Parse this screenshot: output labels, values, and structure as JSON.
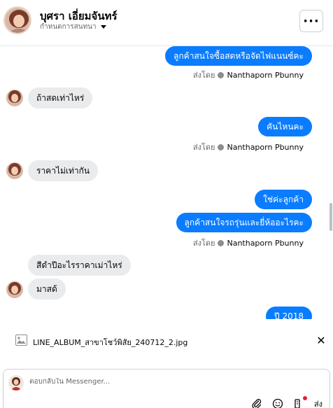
{
  "header": {
    "contact_name": "บุศรา เอี่ยมจันทร์",
    "assign_label": "กำหนดการสนทนา",
    "more_label": "···"
  },
  "messages": {
    "m1": "ลูกค้าสนใจซื้อสดหรือจัดไฟแนนซ์คะ",
    "m2": "ถ้าสดเท่าไหร่",
    "m3": "คันไหนคะ",
    "m4": "ราคาไม่เท่ากัน",
    "m5": "ใช่ค่ะลูกค้า",
    "m6": "ลูกค้าสนใจรถรุ่นและยี่ห้ออะไรคะ",
    "m7": "สีดำปีอะไรราคาเม่าไหร่",
    "m8": "มาสด้",
    "m9": "ปี 2018"
  },
  "sent_by": {
    "prefix": "ส่งโดย",
    "agent": "Nanthaporn Pbunny"
  },
  "attachment": {
    "file_name": "LINE_ALBUM_สาขาโชว์พิสัย_240712_2.jpg",
    "close_label": "✕"
  },
  "composer": {
    "placeholder": "ตอบกลับใน Messenger...",
    "send_label": "ส่ง"
  },
  "colors": {
    "outgoing_bubble": "#0a7cff",
    "incoming_bubble": "#eaebed",
    "notification_dot": "#e41e3f"
  }
}
